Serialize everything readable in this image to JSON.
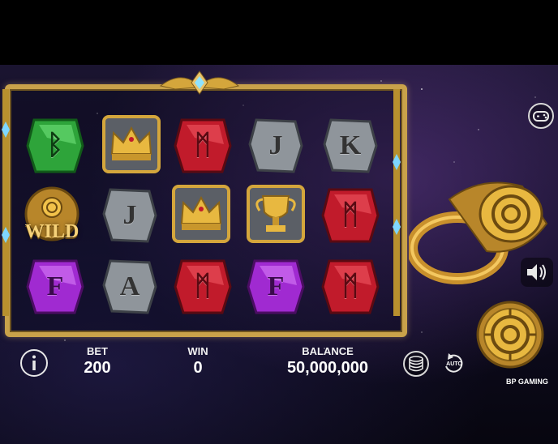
{
  "game": {
    "reels": [
      [
        {
          "symbol": "rune-B",
          "color": "green",
          "text": "ᛒ"
        },
        {
          "symbol": "crown",
          "color": "gold",
          "text": ""
        },
        {
          "symbol": "rune-M",
          "color": "red",
          "text": "ᛗ"
        },
        {
          "symbol": "J",
          "color": "grey",
          "text": "J"
        },
        {
          "symbol": "K",
          "color": "grey",
          "text": "K"
        }
      ],
      [
        {
          "symbol": "wild",
          "color": "gold",
          "text": "WILD"
        },
        {
          "symbol": "J",
          "color": "grey",
          "text": "J"
        },
        {
          "symbol": "crown",
          "color": "gold",
          "text": ""
        },
        {
          "symbol": "trophy",
          "color": "gold",
          "text": ""
        },
        {
          "symbol": "rune-M",
          "color": "red",
          "text": "ᛗ"
        }
      ],
      [
        {
          "symbol": "F",
          "color": "purple",
          "text": "F"
        },
        {
          "symbol": "A",
          "color": "grey",
          "text": "A"
        },
        {
          "symbol": "rune-M",
          "color": "red",
          "text": "ᛗ"
        },
        {
          "symbol": "F",
          "color": "purple",
          "text": "F"
        },
        {
          "symbol": "rune-M",
          "color": "red",
          "text": "ᛗ"
        }
      ]
    ]
  },
  "hud": {
    "bet_label": "BET",
    "bet_value": "200",
    "win_label": "WIN",
    "win_value": "0",
    "balance_label": "BALANCE",
    "balance_value": "50,000,000",
    "auto_label": "AUTO",
    "brand": "BP GAMING"
  },
  "colors": {
    "gold": "#d4a63c",
    "green": "#2ea43a",
    "red": "#c11b2b",
    "purple": "#a02ad1",
    "grey": "#8f959b"
  }
}
